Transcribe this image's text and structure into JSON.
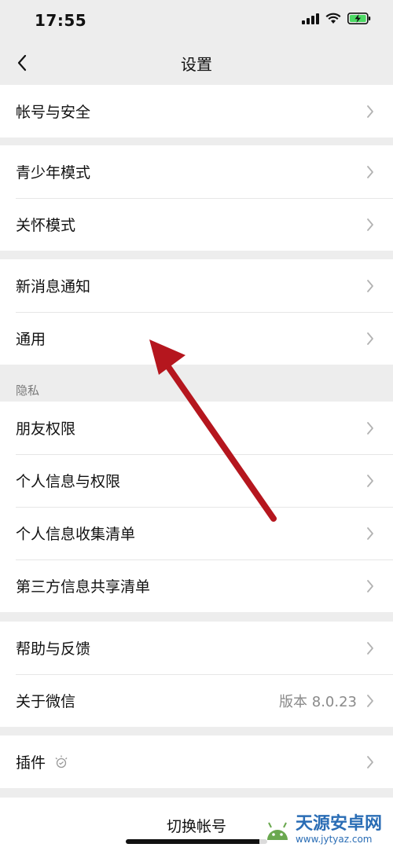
{
  "status_bar": {
    "time": "17:55",
    "icons": [
      "signal-icon",
      "wifi-icon",
      "battery-charging-icon"
    ]
  },
  "nav": {
    "title": "设置",
    "back_icon": "chevron-left-icon"
  },
  "groups": {
    "account": {
      "items": [
        {
          "label": "帐号与安全"
        }
      ]
    },
    "modes": {
      "items": [
        {
          "label": "青少年模式"
        },
        {
          "label": "关怀模式"
        }
      ]
    },
    "general": {
      "items": [
        {
          "label": "新消息通知"
        },
        {
          "label": "通用"
        }
      ]
    },
    "privacy": {
      "header": "隐私",
      "items": [
        {
          "label": "朋友权限"
        },
        {
          "label": "个人信息与权限"
        },
        {
          "label": "个人信息收集清单"
        },
        {
          "label": "第三方信息共享清单"
        }
      ]
    },
    "about": {
      "items": [
        {
          "label": "帮助与反馈"
        },
        {
          "label": "关于微信",
          "value": "版本 8.0.23"
        }
      ]
    },
    "plugins": {
      "items": [
        {
          "label": "插件",
          "icon": "lightbulb-icon"
        }
      ]
    }
  },
  "switch_account": {
    "label": "切换帐号"
  },
  "watermark": {
    "title": "天源安卓网",
    "url": "www.jytyaz.com"
  },
  "colors": {
    "background": "#ededed",
    "row_background": "#ffffff",
    "arrow": "#b5161e",
    "chevron": "#b2b2b2",
    "secondary_text": "#8a8a8a"
  }
}
